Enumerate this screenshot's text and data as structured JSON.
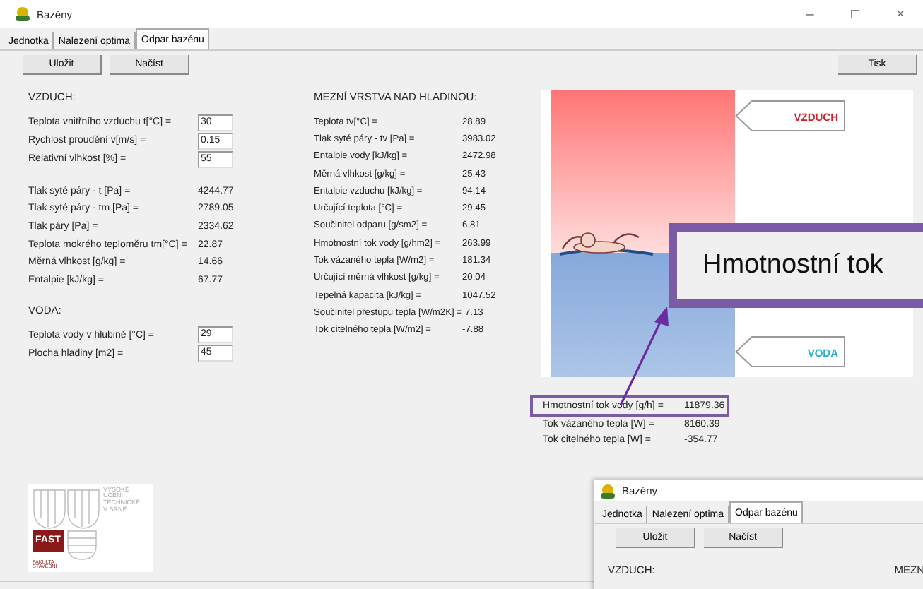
{
  "window": {
    "title": "Bazény",
    "controls": [
      "–",
      "□",
      "×"
    ]
  },
  "tabs": [
    {
      "label": "Jednotka",
      "selected": false
    },
    {
      "label": "Nalezení optima",
      "selected": false
    },
    {
      "label": "Odpar bazénu",
      "selected": true
    }
  ],
  "toolbar": {
    "buttons": [
      "Uložit",
      "Načíst"
    ],
    "print_button": "Tisk"
  },
  "air": {
    "heading": "VZDUCH:",
    "inputs": [
      {
        "label": "Teplota vnitřního vzduchu t[°C] =",
        "value": "30"
      },
      {
        "label": "Rychlost proudění v[m/s] =",
        "value": "0.15"
      },
      {
        "label": "Relativní vlhkost [%] =",
        "value": "55"
      }
    ],
    "results": [
      {
        "label": "Tlak syté páry - t [Pa] =",
        "value": "4244.77"
      },
      {
        "label": "Tlak syté páry - tm [Pa] =",
        "value": "2789.05"
      },
      {
        "label": "Tlak páry [Pa] =",
        "value": "2334.62"
      },
      {
        "label": "Teplota mokrého teploměru tm[°C] =",
        "value": "22.87"
      },
      {
        "label": "Měrná vlhkost [g/kg] =",
        "value": "14.66"
      },
      {
        "label": "Entalpie [kJ/kg] =",
        "value": "67.77"
      }
    ]
  },
  "water": {
    "heading": "VODA:",
    "inputs": [
      {
        "label": "Teplota vody v hlubině [°C] =",
        "value": "29"
      },
      {
        "label": "Plocha hladiny [m2] =",
        "value": "45"
      }
    ]
  },
  "boundary_layer": {
    "heading": "MEZNÍ VRSTVA NAD HLADINOU:",
    "results": [
      {
        "label": "Teplota tv[°C] =",
        "value": "28.89"
      },
      {
        "label": "Tlak syté páry - tv [Pa] =",
        "value": "3983.02"
      },
      {
        "label": "Entalpie vody [kJ/kg] =",
        "value": "2472.98"
      },
      {
        "label": "Měrná vlhkost [g/kg] =",
        "value": "25.43"
      },
      {
        "label": "Entalpie vzduchu [kJ/kg] =",
        "value": "94.14"
      },
      {
        "label": "Určující teplota [°C] =",
        "value": "29.45"
      },
      {
        "label": "Součinitel odparu [g/sm2] =",
        "value": "6.81"
      },
      {
        "label": "Hmotnostní tok vody [g/hm2] =",
        "value": "263.99"
      },
      {
        "label": "Tok vázaného tepla [W/m2] =",
        "value": "181.34"
      },
      {
        "label": "Určující měrná vlhkost [g/kg] =",
        "value": "20.04"
      },
      {
        "label": "Tepelná kapacita [kJ/kg] =",
        "value": "1047.52"
      },
      {
        "label": "Součinitel přestupu tepla [W/m2K] =",
        "value": "7.13"
      },
      {
        "label": "Tok citelného tepla [W/m2] =",
        "value": "-7.88"
      }
    ]
  },
  "diagram": {
    "air_label": "VZDUCH",
    "water_label": "VODA"
  },
  "totals": [
    {
      "label": "Hmotnostní tok vody [g/h] =",
      "value": "11879.36",
      "highlighted": true
    },
    {
      "label": "Tok vázaného tepla [W] =",
      "value": "8160.39",
      "highlighted": false
    },
    {
      "label": "Tok citelného tepla [W] =",
      "value": "-354.77",
      "highlighted": false
    }
  ],
  "callout": {
    "text": "Hmotnostní tok"
  },
  "logo": {
    "university": "VYSOKÉ UČENÍ TECHNICKÉ V BRNĚ",
    "mark": "FAST",
    "faculty": "FAKULTA STAVEBNÍ"
  },
  "inset_window": {
    "title": "Bazény",
    "tabs": [
      {
        "label": "Jednotka",
        "selected": false
      },
      {
        "label": "Nalezení optima",
        "selected": false
      },
      {
        "label": "Odpar bazénu",
        "selected": true
      }
    ],
    "buttons": [
      "Uložit",
      "Načíst"
    ],
    "section_left": "VZDUCH:",
    "section_right": "MEZN"
  }
}
